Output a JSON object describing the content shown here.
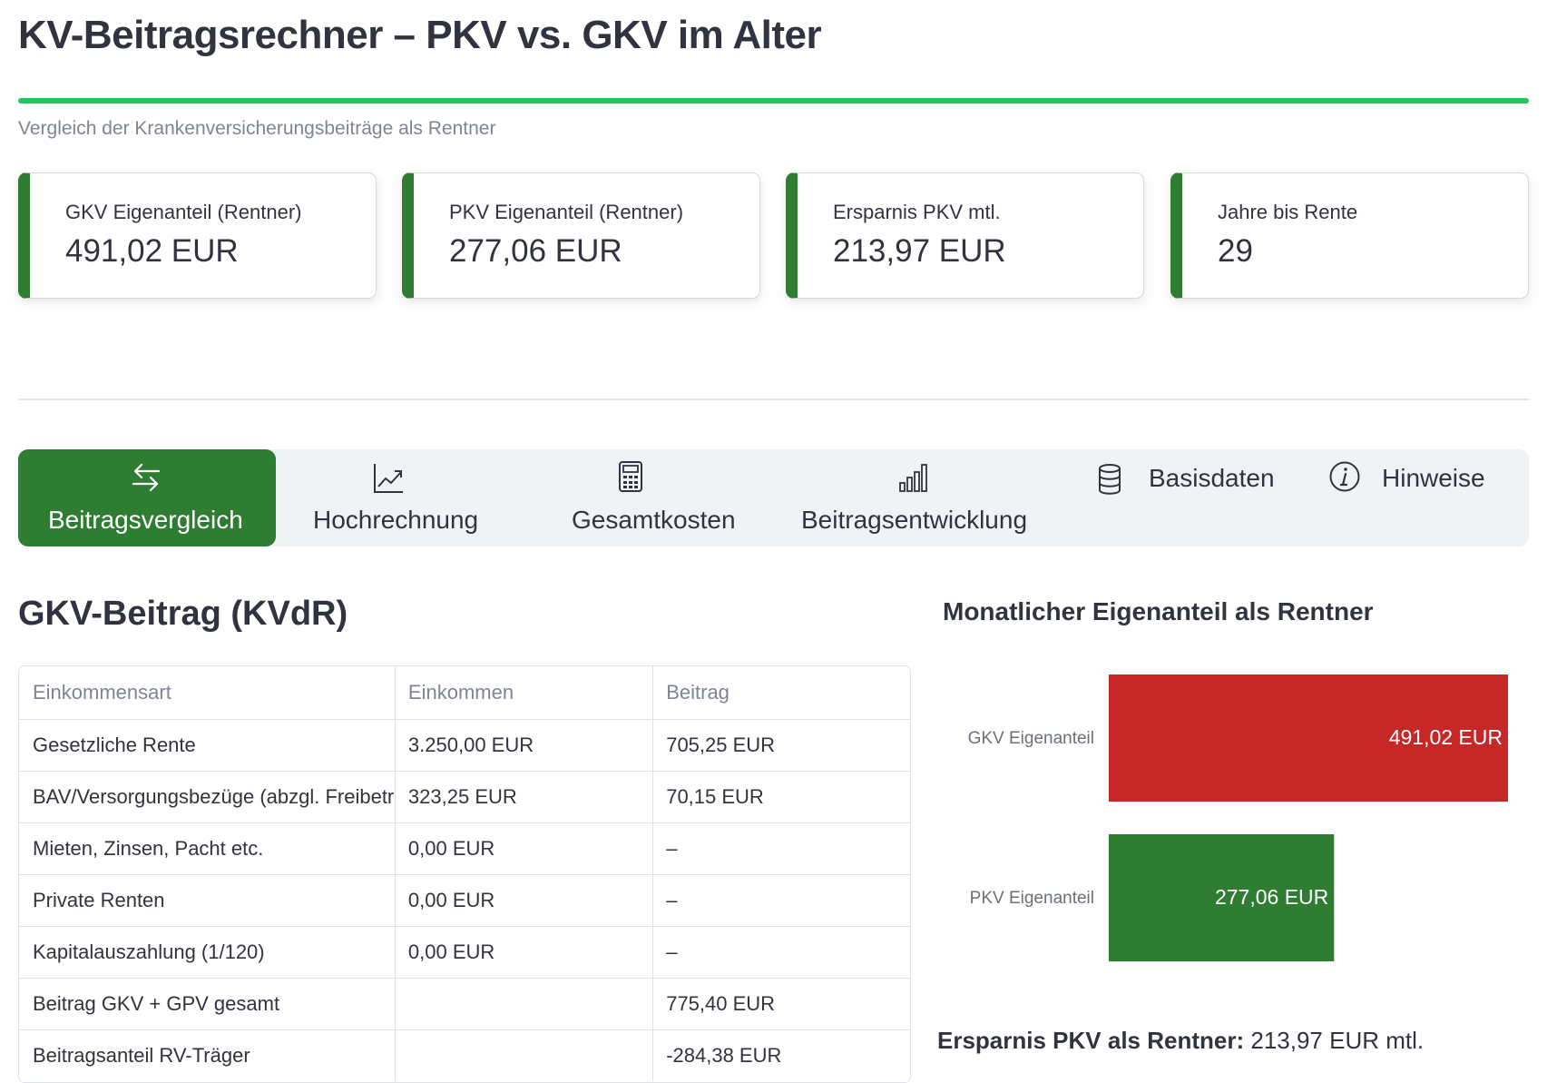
{
  "header": {
    "title": "KV-Beitragsrechner – PKV vs. GKV im Alter",
    "subtitle": "Vergleich der Krankenversicherungsbeiträge als Rentner"
  },
  "colors": {
    "accent": "#2e7d32",
    "rule": "#22c55e",
    "gkv_bar": "#c62828",
    "pkv_bar": "#2e7d32"
  },
  "metrics": [
    {
      "label": "GKV Eigenanteil (Rentner)",
      "value": "491,02 EUR"
    },
    {
      "label": "PKV Eigenanteil (Rentner)",
      "value": "277,06 EUR"
    },
    {
      "label": "Ersparnis PKV mtl.",
      "value": "213,97 EUR"
    },
    {
      "label": "Jahre bis Rente",
      "value": "29"
    }
  ],
  "tabs": [
    {
      "label": "Beitragsvergleich",
      "icon": "arrows-exchange-icon",
      "active": true
    },
    {
      "label": "Hochrechnung",
      "icon": "trending-chart-icon",
      "active": false
    },
    {
      "label": "Gesamtkosten",
      "icon": "calculator-icon",
      "active": false
    },
    {
      "label": "Beitragsentwicklung",
      "icon": "bar-chart-icon",
      "active": false
    },
    {
      "label": "Basisdaten",
      "icon": "database-icon",
      "active": false
    },
    {
      "label": "Hinweise",
      "icon": "info-icon",
      "active": false
    }
  ],
  "gkv": {
    "title": "GKV-Beitrag (KVdR)",
    "columns": [
      "Einkommensart",
      "Einkommen",
      "Beitrag"
    ],
    "rows": [
      [
        "Gesetzliche Rente",
        "3.250,00 EUR",
        "705,25 EUR"
      ],
      [
        "BAV/Versorgungsbezüge (abzgl. Freibetrag)",
        "323,25 EUR",
        "70,15 EUR"
      ],
      [
        "Mieten, Zinsen, Pacht etc.",
        "0,00 EUR",
        "–"
      ],
      [
        "Private Renten",
        "0,00 EUR",
        "–"
      ],
      [
        "Kapitalauszahlung (1/120)",
        "0,00 EUR",
        "–"
      ],
      [
        "Beitrag GKV + GPV gesamt",
        "",
        "775,40 EUR"
      ],
      [
        "Beitragsanteil RV-Träger",
        "",
        "-284,38 EUR"
      ]
    ]
  },
  "chart": {
    "title": "Monatlicher Eigenanteil als Rentner"
  },
  "chart_data": {
    "type": "bar",
    "orientation": "horizontal",
    "title": "Monatlicher Eigenanteil als Rentner",
    "categories": [
      "GKV Eigenanteil",
      "PKV Eigenanteil"
    ],
    "values": [
      491.02,
      277.06
    ],
    "value_labels": [
      "491,02 EUR",
      "277,06 EUR"
    ],
    "colors": [
      "#c62828",
      "#2e7d32"
    ],
    "xlim": [
      0,
      491.02
    ],
    "grid": false,
    "legend": "none"
  },
  "summary": {
    "savings_label": "Ersparnis PKV als Rentner:",
    "savings_value": "213,97 EUR mtl."
  }
}
